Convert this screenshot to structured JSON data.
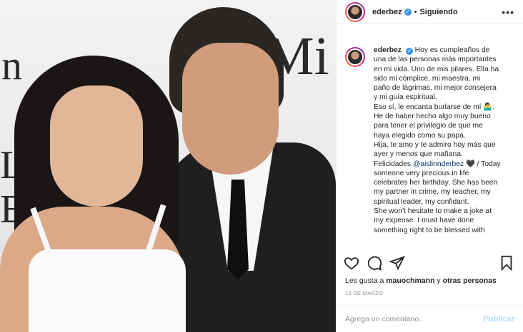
{
  "photo": {
    "alt_letters": {
      "n": "n",
      "mi": "Mi",
      "l": "L",
      "e": "E"
    }
  },
  "post": {
    "username": "ederbez",
    "dot": "•",
    "follow_status": "Siguiendo",
    "more": "•••",
    "caption_lines": [
      "Hoy es cumpleaños de",
      "una de las personas más importantes",
      "en mi vida. Uno de mis pilares. Ella ha",
      "sido mi cómplice, mi maestra, mi",
      "paño de lágrimas, mi mejor consejera",
      "y mi guía espiritual.",
      "Eso sí, le encanta burlarse de mí 🤷‍♂️.",
      "He de haber hecho algo muy bueno",
      "para tener el privilegio de que me",
      "haya elegido como su papá.",
      "Hija, te amo y te admiro hoy más que",
      "ayer y menos que mañana."
    ],
    "caption_felicidades_prefix": "Felicidades ",
    "caption_mention": "@aislinnderbez",
    "caption_felicidades_suffix": " 🖤 / Today",
    "caption_lines_2": [
      "someone very precious in life",
      "celebrates her birthday. She has been",
      "my partner in crime, my teacher, my",
      "spiritual leader, my confidant.",
      "She won't hesitate to make a joke at",
      "my expense. I must have done",
      "something right to be blessed with"
    ],
    "likes_prefix": "Les gusta a ",
    "likes_user": "mauochmann",
    "likes_suffix": " y ",
    "likes_others": "otras personas",
    "date": "18 DE MARZO",
    "comment_placeholder": "Agrega un comentario...",
    "publish_label": "Publicar"
  },
  "colors": {
    "verified": "#3897f0",
    "mention": "#00376b",
    "publish_disabled": "#b3dbff"
  }
}
